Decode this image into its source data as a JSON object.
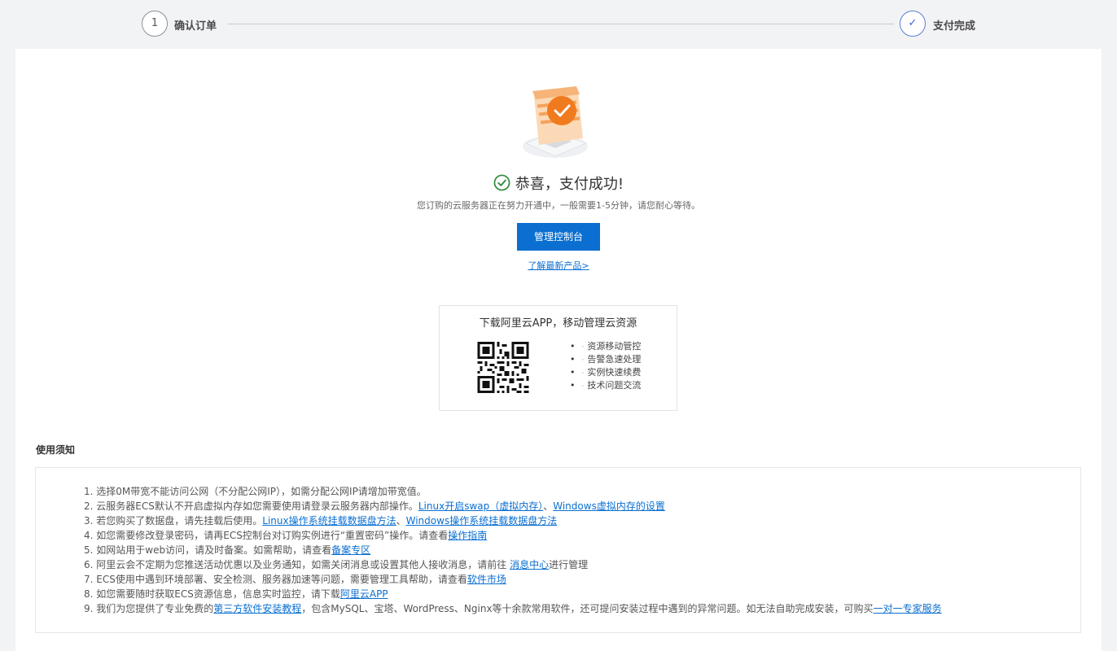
{
  "steps": [
    {
      "marker": "1",
      "label": "确认订单"
    },
    {
      "marker": "✓",
      "label": "支付完成"
    }
  ],
  "success": {
    "title": "恭喜，支付成功!",
    "subtitle": "您订购的云服务器正在努力开通中，一般需要1-5分钟，请您耐心等待。",
    "console_button": "管理控制台",
    "learn_link": "了解最新产品>"
  },
  "app_promo": {
    "title": "下载阿里云APP，移动管理云资源",
    "features": [
      "资源移动管控",
      "告警急速处理",
      "实例快速续费",
      "技术问题交流"
    ]
  },
  "notice": {
    "title": "使用须知",
    "items": [
      {
        "prefix": "1. 选择0M带宽不能访问公网（不分配公网IP），如需分配公网IP请增加带宽值。"
      },
      {
        "prefix": "2. 云服务器ECS默认不开启虚拟内存如您需要使用请登录云服务器内部操作。",
        "link1": "Linux开启swap（虚拟内存）",
        "mid": "、",
        "link2": "Windows虚拟内存的设置"
      },
      {
        "prefix": "3. 若您购买了数据盘，请先挂载后使用。",
        "link1": "Linux操作系统挂载数据盘方法",
        "mid": "、",
        "link2": "Windows操作系统挂载数据盘方法"
      },
      {
        "prefix": "4. 如您需要修改登录密码，请再ECS控制台对订购实例进行“重置密码”操作。请查看",
        "link1": "操作指南"
      },
      {
        "prefix": "5. 如网站用于web访问，请及时备案。如需帮助，请查看",
        "link1": "备案专区"
      },
      {
        "prefix": "6. 阿里云会不定期为您推送活动优惠以及业务通知，如需关闭消息或设置其他人接收消息，请前往 ",
        "link1": "消息中心",
        "suffix": "进行管理"
      },
      {
        "prefix": "7. ECS使用中遇到环境部署、安全检测、服务器加速等问题，需要管理工具帮助，请查看",
        "link1": "软件市场"
      },
      {
        "prefix": "8. 如您需要随时获取ECS资源信息，信息实时监控，请下载",
        "link1": "阿里云APP"
      },
      {
        "prefix": "9. 我们为您提供了专业免费的",
        "link1": "第三方软件安装教程",
        "mid": "，包含MySQL、宝塔、WordPress、Nginx等十余款常用软件，还可提问安装过程中遇到的异常问题。如无法自助完成安装，可购买",
        "link2": "一对一专家服务"
      }
    ]
  },
  "colors": {
    "accent": "#0a6fd1",
    "success": "#2e8b3e",
    "illustration": "#f07a1e"
  }
}
